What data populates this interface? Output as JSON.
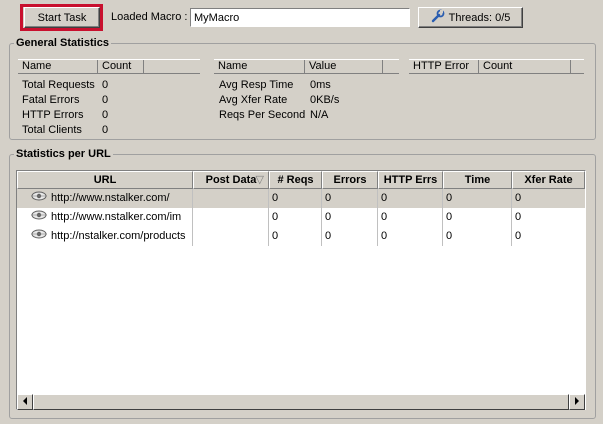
{
  "toolbar": {
    "start_label": "Start Task",
    "loaded_macro_label": "Loaded Macro :",
    "macro_value": "MyMacro",
    "threads_label": "Threads: 0/5"
  },
  "general": {
    "title": "General Statistics",
    "table1": {
      "headers": [
        "Name",
        "Count"
      ],
      "rows": [
        {
          "name": "Total Requests",
          "value": "0"
        },
        {
          "name": "Fatal Errors",
          "value": "0"
        },
        {
          "name": "HTTP Errors",
          "value": "0"
        },
        {
          "name": "Total Clients",
          "value": "0"
        }
      ]
    },
    "table2": {
      "headers": [
        "Name",
        "Value"
      ],
      "rows": [
        {
          "name": "Avg Resp Time",
          "value": "0ms"
        },
        {
          "name": "Avg Xfer Rate",
          "value": "0KB/s"
        },
        {
          "name": "Reqs Per Second",
          "value": "N/A"
        }
      ]
    },
    "table3": {
      "headers": [
        "HTTP Error",
        "Count"
      ]
    }
  },
  "per_url": {
    "title": "Statistics per URL",
    "columns": [
      "URL",
      "Post Data",
      "# Reqs",
      "Errors",
      "HTTP Errs",
      "Time",
      "Xfer Rate"
    ],
    "sort_indicator": "▽",
    "rows": [
      {
        "url": "http://www.nstalker.com/",
        "post_data": "",
        "reqs": "0",
        "errors": "0",
        "http_errs": "0",
        "time": "0",
        "xfer": "0"
      },
      {
        "url": "http://www.nstalker.com/im",
        "post_data": "",
        "reqs": "0",
        "errors": "0",
        "http_errs": "0",
        "time": "0",
        "xfer": "0"
      },
      {
        "url": "http://nstalker.com/products",
        "post_data": "",
        "reqs": "0",
        "errors": "0",
        "http_errs": "0",
        "time": "0",
        "xfer": "0"
      }
    ]
  },
  "icons": {
    "threads": "wrench-icon",
    "url_row": "eye-icon"
  }
}
